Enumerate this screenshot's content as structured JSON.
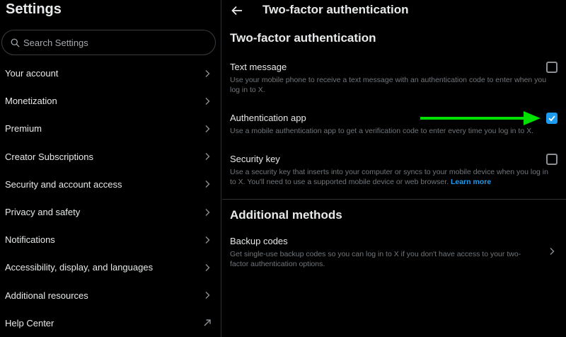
{
  "sidebar": {
    "title": "Settings",
    "search_placeholder": "Search Settings",
    "items": [
      {
        "label": "Your account"
      },
      {
        "label": "Monetization"
      },
      {
        "label": "Premium"
      },
      {
        "label": "Creator Subscriptions"
      },
      {
        "label": "Security and account access"
      },
      {
        "label": "Privacy and safety"
      },
      {
        "label": "Notifications"
      },
      {
        "label": "Accessibility, display, and languages"
      },
      {
        "label": "Additional resources"
      },
      {
        "label": "Help Center"
      }
    ]
  },
  "header": {
    "title": "Two-factor authentication"
  },
  "main": {
    "section1_title": "Two-factor authentication",
    "options": [
      {
        "title": "Text message",
        "description": "Use your mobile phone to receive a text message with an authentication code to enter when you log in to X.",
        "checked": false
      },
      {
        "title": "Authentication app",
        "description": "Use a mobile authentication app to get a verification code to enter every time you log in to X.",
        "checked": true
      },
      {
        "title": "Security key",
        "description": "Use a security key that inserts into your computer or syncs to your mobile device when you log in to X. You'll need to use a supported mobile device or web browser.",
        "link": "Learn more",
        "checked": false
      }
    ],
    "section2_title": "Additional methods",
    "backup": {
      "title": "Backup codes",
      "description": "Get single-use backup codes so you can log in to X if you don't have access to your two-factor authentication options."
    }
  },
  "colors": {
    "accent": "#1d9bf0",
    "annotation_arrow": "#00e000",
    "background": "#000000"
  }
}
